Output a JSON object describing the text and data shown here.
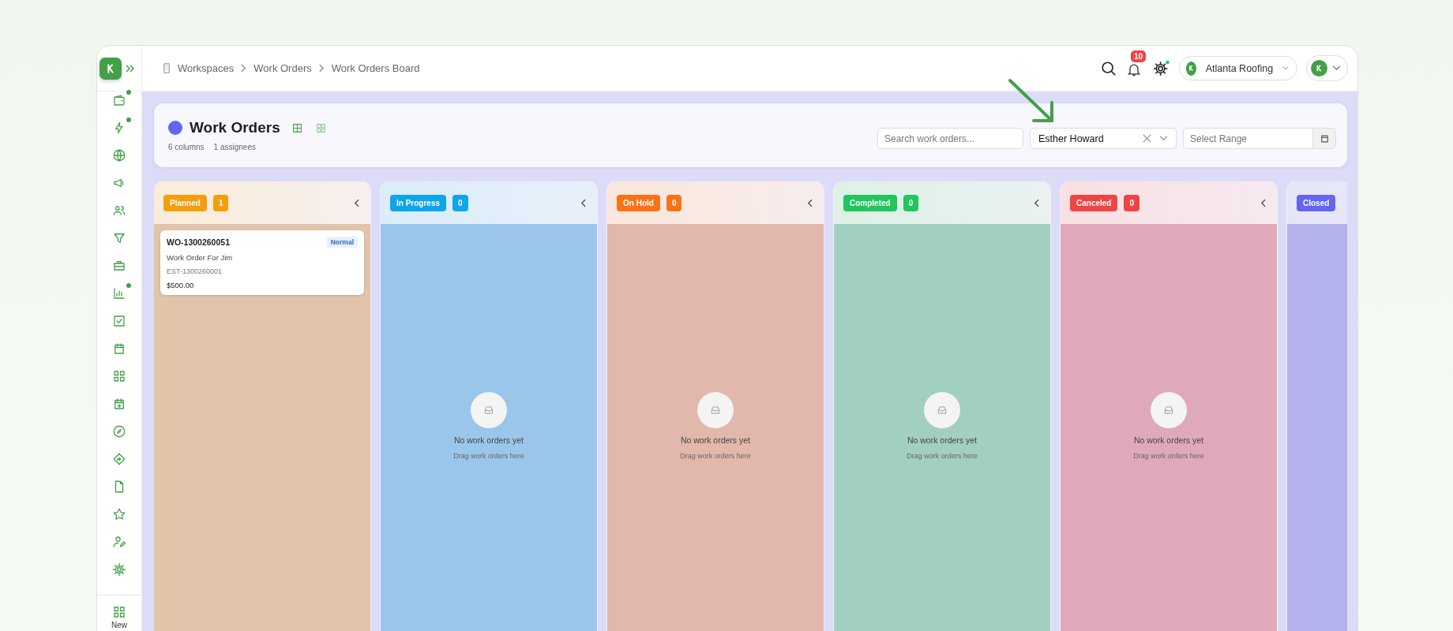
{
  "topbar": {
    "breadcrumb": [
      "Workspaces",
      "Work Orders",
      "Work Orders Board"
    ],
    "notification_count": "10",
    "company": "Atlanta Roofing"
  },
  "sidebar": {
    "items": [
      {
        "dot": true
      },
      {
        "dot": true
      },
      {
        "dot": false
      },
      {
        "dot": false
      },
      {
        "dot": false
      },
      {
        "dot": false
      },
      {
        "dot": false
      },
      {
        "dot": true
      },
      {
        "dot": false
      },
      {
        "dot": false
      },
      {
        "dot": false
      },
      {
        "dot": false
      },
      {
        "dot": false
      },
      {
        "dot": false
      },
      {
        "dot": false
      },
      {
        "dot": false
      },
      {
        "dot": false
      },
      {
        "dot": false
      }
    ],
    "new_label": "New"
  },
  "header": {
    "title": "Work Orders",
    "color": "#6366f1",
    "stats": [
      "6 columns",
      "1 assignees"
    ],
    "views": [
      {
        "selected": true
      },
      {
        "selected": false
      }
    ],
    "search": {
      "placeholder": "Search work orders..."
    },
    "assignee": {
      "value": "Esther Howard"
    },
    "date_range": {
      "placeholder": "Select Range"
    }
  },
  "columns": [
    {
      "title": "Planned",
      "count": "1",
      "color": "#f59e0b",
      "cards": [
        {
          "number": "WO-1300260051",
          "priority": "Normal",
          "title": "Work Order For Jim",
          "estimate": "EST-1300260001",
          "amount": "$500.00"
        }
      ]
    },
    {
      "title": "In Progress",
      "count": "0",
      "color": "#0ea5e9",
      "empty": {
        "title": "No work orders yet",
        "hint": "Drag work orders here"
      }
    },
    {
      "title": "On Hold",
      "count": "0",
      "color": "#f97316",
      "empty": {
        "title": "No work orders yet",
        "hint": "Drag work orders here"
      }
    },
    {
      "title": "Completed",
      "count": "0",
      "color": "#22c55e",
      "empty": {
        "title": "No work orders yet",
        "hint": "Drag work orders here"
      }
    },
    {
      "title": "Canceled",
      "count": "0",
      "color": "#ef4444",
      "empty": {
        "title": "No work orders yet",
        "hint": "Drag work orders here"
      }
    },
    {
      "title": "Closed",
      "color": "#6366f1"
    }
  ]
}
